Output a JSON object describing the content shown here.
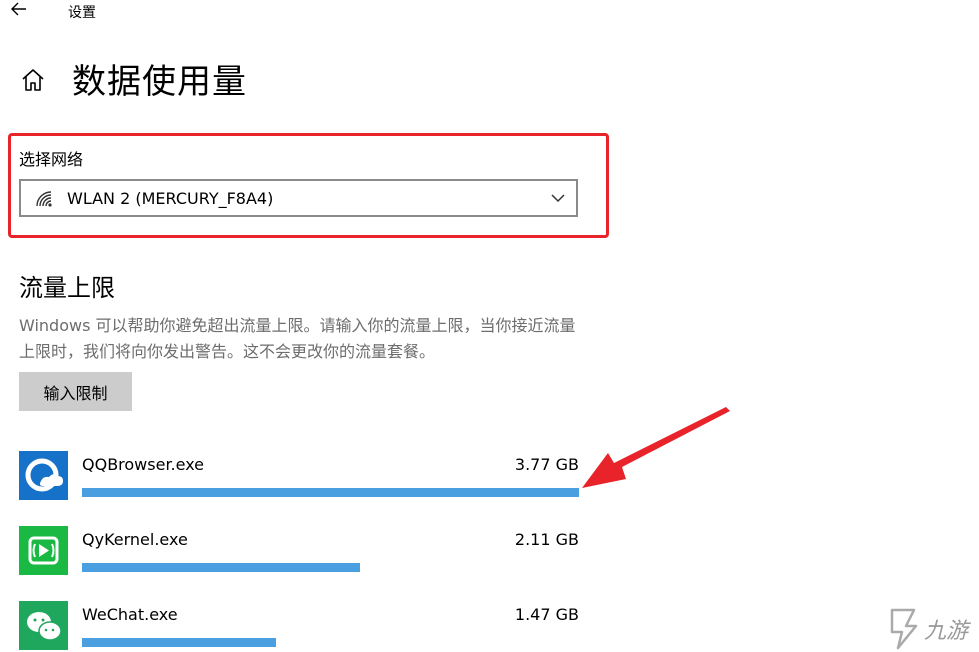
{
  "window": {
    "title": "设置"
  },
  "header": {
    "page_title": "数据使用量"
  },
  "network": {
    "label": "选择网络",
    "selected": "WLAN 2 (MERCURY_F8A4)"
  },
  "limit": {
    "title": "流量上限",
    "description": "Windows 可以帮助你避免超出流量上限。请输入你的流量上限，当你接近流量上限时，我们将向你发出警告。这不会更改你的流量套餐。",
    "button_label": "输入限制"
  },
  "apps": [
    {
      "name": "QQBrowser.exe",
      "size": "3.77 GB",
      "usage_fraction": 1.0,
      "icon": "qqbrowser-icon"
    },
    {
      "name": "QyKernel.exe",
      "size": "2.11 GB",
      "usage_fraction": 0.56,
      "icon": "qykernel-icon"
    },
    {
      "name": "WeChat.exe",
      "size": "1.47 GB",
      "usage_fraction": 0.39,
      "icon": "wechat-icon"
    }
  ],
  "colors": {
    "highlight": "#e8232a",
    "usage_bar": "#4a9fe0",
    "arrow": "#e8232a"
  },
  "watermark": {
    "text": "九游"
  }
}
